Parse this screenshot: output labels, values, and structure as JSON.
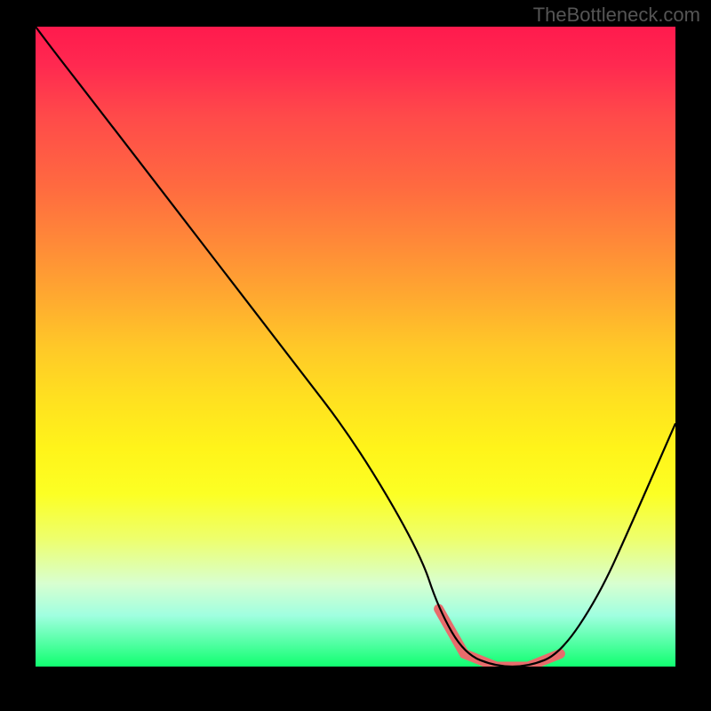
{
  "watermark": "TheBottleneck.com",
  "chart_data": {
    "type": "line",
    "title": "",
    "xlabel": "",
    "ylabel": "",
    "xlim": [
      0,
      100
    ],
    "ylim": [
      0,
      100
    ],
    "grid": false,
    "series": [
      {
        "name": "curve",
        "x": [
          0,
          3,
          10,
          20,
          30,
          40,
          50,
          60,
          63,
          67,
          72,
          77,
          82,
          88,
          93,
          100
        ],
        "y": [
          100,
          96,
          87,
          74,
          61,
          48,
          35,
          18,
          9,
          2,
          0,
          0,
          2,
          11,
          22,
          38
        ]
      }
    ],
    "highlight_segment": {
      "name": "minimum-plateau",
      "x": [
        63,
        67,
        72,
        77,
        82
      ],
      "y": [
        9,
        2,
        0,
        0,
        2
      ],
      "color": "#e86c6c"
    },
    "background_gradient": {
      "top": "#ff1a4d",
      "bottom": "#10ff70",
      "stops": [
        "red",
        "orange",
        "yellow",
        "green"
      ]
    }
  }
}
